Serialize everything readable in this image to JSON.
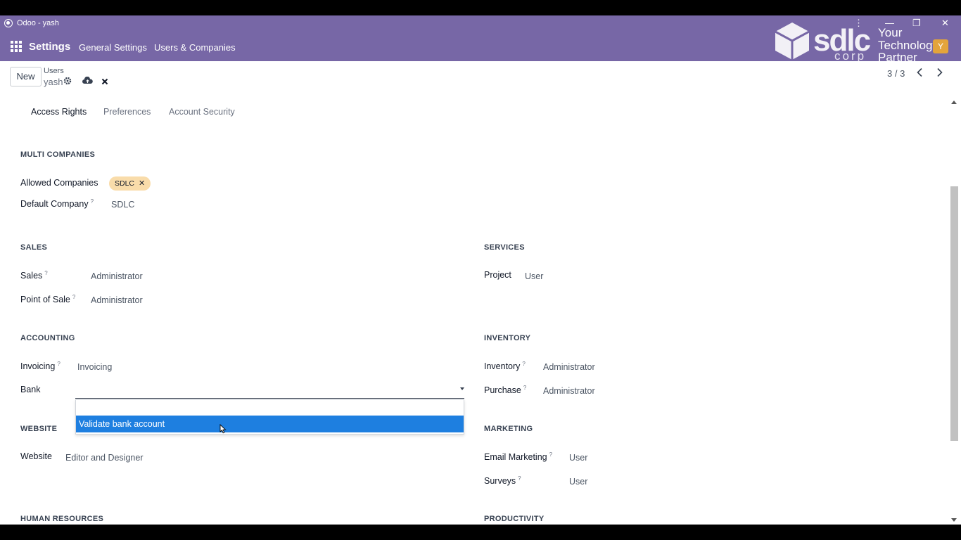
{
  "window": {
    "title": "Odoo - yash",
    "menu_icon": "kebab-menu-icon",
    "min_label": "—",
    "restore_label": "❐",
    "close_label": "✕"
  },
  "navbar": {
    "brand": "Settings",
    "links": [
      "General Settings",
      "Users & Companies"
    ],
    "logo": {
      "word": "sdlc",
      "corp": "corp",
      "line1": "Your",
      "line2": "Technology",
      "line3": "Partner",
      "badge": "Y"
    }
  },
  "control_panel": {
    "new_label": "New",
    "breadcrumb_parent": "Users",
    "breadcrumb_current": "yash",
    "pager": "3 / 3"
  },
  "tabs": [
    "Access Rights",
    "Preferences",
    "Account Security"
  ],
  "multi_companies": {
    "title": "MULTI COMPANIES",
    "allowed_label": "Allowed Companies",
    "allowed_tag": "SDLC",
    "default_label": "Default Company",
    "default_help": "?",
    "default_value": "SDLC"
  },
  "sales": {
    "title": "SALES",
    "rows": [
      {
        "label": "Sales",
        "help": "?",
        "value": "Administrator"
      },
      {
        "label": "Point of Sale",
        "help": "?",
        "value": "Administrator"
      }
    ]
  },
  "services": {
    "title": "SERVICES",
    "rows": [
      {
        "label": "Project",
        "value": "User"
      }
    ]
  },
  "accounting": {
    "title": "ACCOUNTING",
    "invoicing_label": "Invoicing",
    "invoicing_help": "?",
    "invoicing_value": "Invoicing",
    "bank_label": "Bank",
    "bank_value": "",
    "dropdown_options": [
      "Validate bank account"
    ]
  },
  "inventory": {
    "title": "INVENTORY",
    "rows": [
      {
        "label": "Inventory",
        "help": "?",
        "value": "Administrator"
      },
      {
        "label": "Purchase",
        "help": "?",
        "value": "Administrator"
      }
    ]
  },
  "website": {
    "title": "WEBSITE",
    "label": "Website",
    "value": "Editor and Designer"
  },
  "marketing": {
    "title": "MARKETING",
    "rows": [
      {
        "label": "Email Marketing",
        "help": "?",
        "value": "User"
      },
      {
        "label": "Surveys",
        "help": "?",
        "value": "User"
      }
    ]
  },
  "human_resources": {
    "title": "HUMAN RESOURCES"
  },
  "productivity": {
    "title": "PRODUCTIVITY"
  }
}
